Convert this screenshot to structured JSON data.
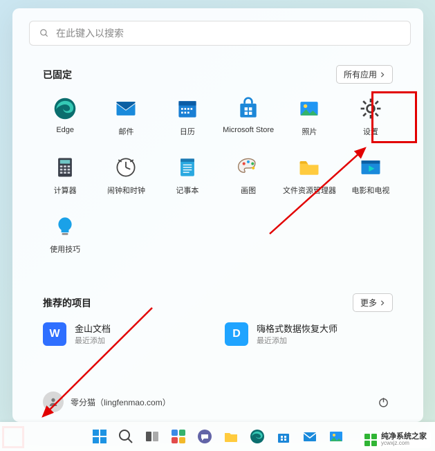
{
  "search": {
    "placeholder": "在此键入以搜索"
  },
  "pinned": {
    "title": "已固定",
    "all_apps_label": "所有应用",
    "apps": [
      {
        "name": "Edge"
      },
      {
        "name": "邮件"
      },
      {
        "name": "日历"
      },
      {
        "name": "Microsoft Store"
      },
      {
        "name": "照片"
      },
      {
        "name": "设置"
      },
      {
        "name": "计算器"
      },
      {
        "name": "闹钟和时钟"
      },
      {
        "name": "记事本"
      },
      {
        "name": "画图"
      },
      {
        "name": "文件资源管理器"
      },
      {
        "name": "电影和电视"
      },
      {
        "name": "使用技巧"
      }
    ]
  },
  "recommended": {
    "title": "推荐的项目",
    "more_label": "更多",
    "items": [
      {
        "title": "金山文档",
        "subtitle": "最近添加",
        "color": "#2f6fff",
        "glyph": "W"
      },
      {
        "title": "嗨格式数据恢复大师",
        "subtitle": "最近添加",
        "color": "#1fa4ff",
        "glyph": "D"
      }
    ]
  },
  "user": {
    "display": "零分猫（lingfenmao.com）"
  },
  "taskbar_icons": [
    "start",
    "search",
    "taskview",
    "widgets",
    "chat",
    "files",
    "edge",
    "store",
    "mail",
    "photos"
  ],
  "watermark": {
    "line1": "纯净系统之家",
    "line2": "ycwxjz.com"
  },
  "annotations": {
    "highlight_settings": true,
    "highlight_start": true,
    "arrows": [
      "to-settings",
      "to-start"
    ]
  }
}
